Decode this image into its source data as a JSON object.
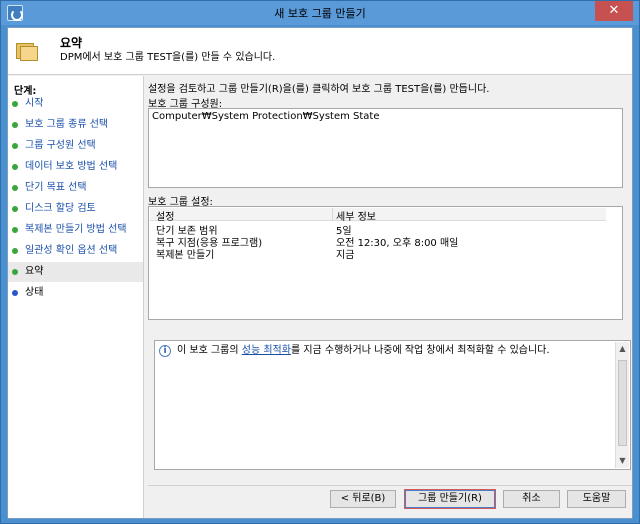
{
  "window": {
    "title": "새 보호 그룹 만들기",
    "close_glyph": "✕"
  },
  "header": {
    "title": "요약",
    "subtitle": "DPM에서 보호 그룹 TEST을(를) 만들 수 있습니다."
  },
  "sidebar": {
    "label": "단계:",
    "items": [
      {
        "label": "시작"
      },
      {
        "label": "보호 그룹 종류 선택"
      },
      {
        "label": "그룹 구성원 선택"
      },
      {
        "label": "데이터 보호 방법 선택"
      },
      {
        "label": "단기 목표 선택"
      },
      {
        "label": "디스크 할당 검토"
      },
      {
        "label": "복제본 만들기 방법 선택"
      },
      {
        "label": "일관성 확인 옵션 선택"
      },
      {
        "label": "요약"
      },
      {
        "label": "상태"
      }
    ]
  },
  "main": {
    "instruction": "설정을 검토하고 그룹 만들기(R)을(를) 클릭하여 보호 그룹 TEST을(를) 만듭니다.",
    "members_label": "보호 그룹 구성원:",
    "members_value": "Computer₩System Protection₩System State",
    "settings_label": "보호 그룹 설정:",
    "settings_columns": [
      "설정",
      "세부 정보"
    ],
    "settings_rows": [
      {
        "setting": "단기 보존 범위",
        "detail": "5일"
      },
      {
        "setting": "복구 지점(응용 프로그램)",
        "detail": "오전 12:30, 오후 8:00 매일"
      },
      {
        "setting": "복제본 만들기",
        "detail": "지금"
      }
    ]
  },
  "info": {
    "text_before": "이 보호 그룹의 ",
    "link": "성능 최적화",
    "text_after": "를 지금 수행하거나 나중에 작업 창에서 최적화할 수 있습니다."
  },
  "buttons": {
    "back": "< 뒤로(B)",
    "create": "그룹 만들기(R)",
    "cancel": "취소",
    "help": "도움말"
  },
  "colors": {
    "link": "#1a4fa8",
    "step_done": "#3aa53a",
    "step_pending": "#2c55c8"
  }
}
